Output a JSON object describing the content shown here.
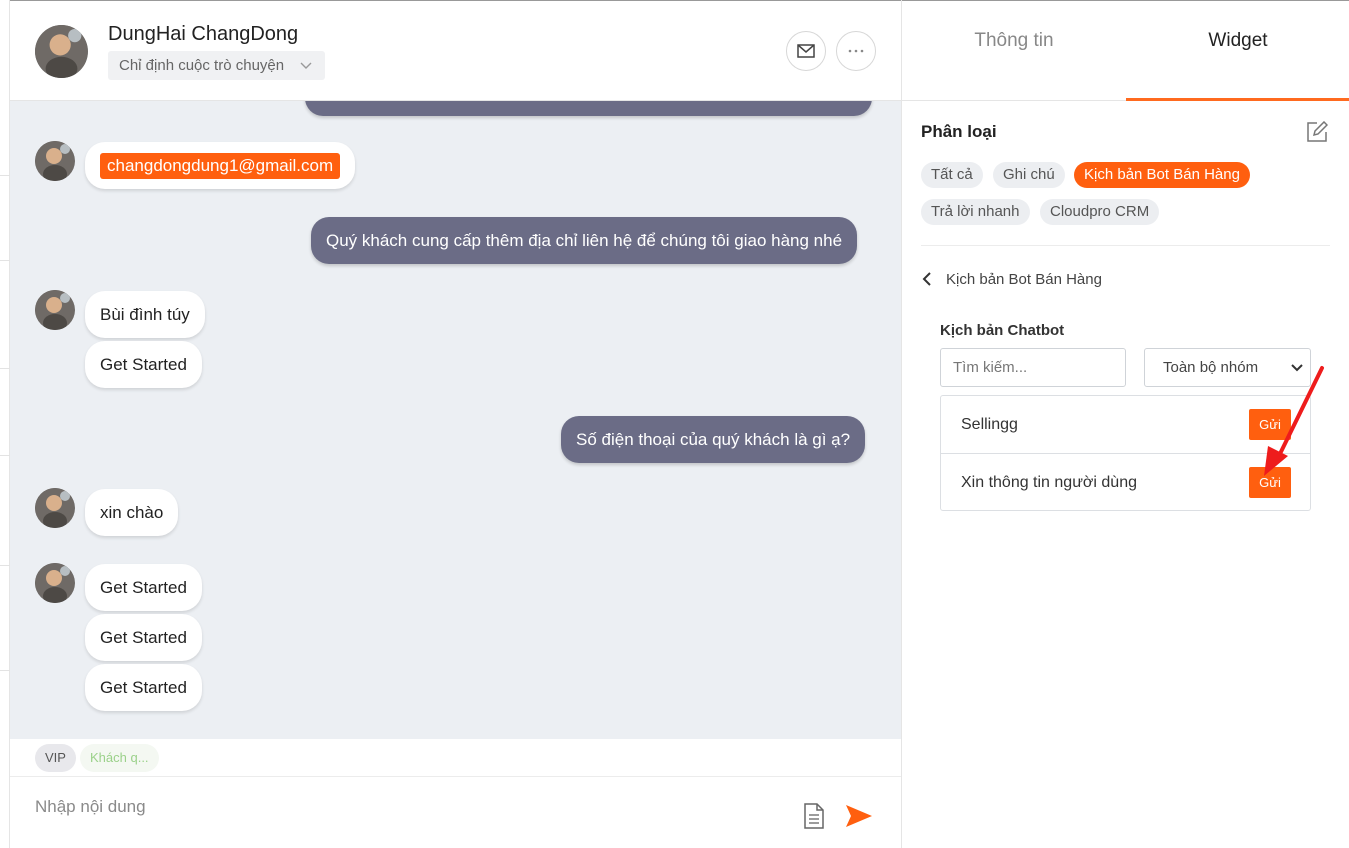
{
  "contact": {
    "name": "DungHai ChangDong",
    "assign_label": "Chỉ định cuộc trò chuyện"
  },
  "header_icons": [
    "mail-icon",
    "more-icon"
  ],
  "messages": [
    {
      "from": "user",
      "text": "changdongdung1@gmail.com"
    },
    {
      "from": "agent",
      "text": "Quý khách cung cấp thêm địa chỉ liên hệ để chúng tôi giao hàng nhé"
    },
    {
      "from": "user",
      "text": "Bùi đình túy"
    },
    {
      "from": "user",
      "text": "Get Started"
    },
    {
      "from": "agent",
      "text": "Số điện thoại của quý khách là gì ạ?"
    },
    {
      "from": "user",
      "text": "xin chào"
    },
    {
      "from": "user",
      "text": "Get Started"
    },
    {
      "from": "user",
      "text": "Get Started"
    },
    {
      "from": "user",
      "text": "Get Started"
    }
  ],
  "tags": [
    "VIP",
    "Khách q..."
  ],
  "composer": {
    "placeholder": "Nhập nội dung"
  },
  "tabs": [
    {
      "label": "Thông tin",
      "active": false
    },
    {
      "label": "Widget",
      "active": true
    }
  ],
  "category": {
    "title": "Phân loại",
    "chips": [
      "Tất cả",
      "Ghi chú",
      "Kịch bản Bot Bán Hàng",
      "Trả lời nhanh",
      "Cloudpro CRM"
    ],
    "active_chip": "Kịch bản Bot Bán Hàng"
  },
  "back_label": "Kịch bản Bot Bán Hàng",
  "chatbot": {
    "title": "Kịch bản Chatbot",
    "search_placeholder": "Tìm kiếm...",
    "group_select": "Toàn bộ nhóm",
    "scripts": [
      {
        "name": "Sellingg",
        "button": "Gửi"
      },
      {
        "name": "Xin thông tin người dùng",
        "button": "Gửi"
      }
    ]
  },
  "colors": {
    "accent": "#ff5f0f",
    "agent_bubble": "#6b6c86",
    "chat_bg": "#eceff3"
  }
}
